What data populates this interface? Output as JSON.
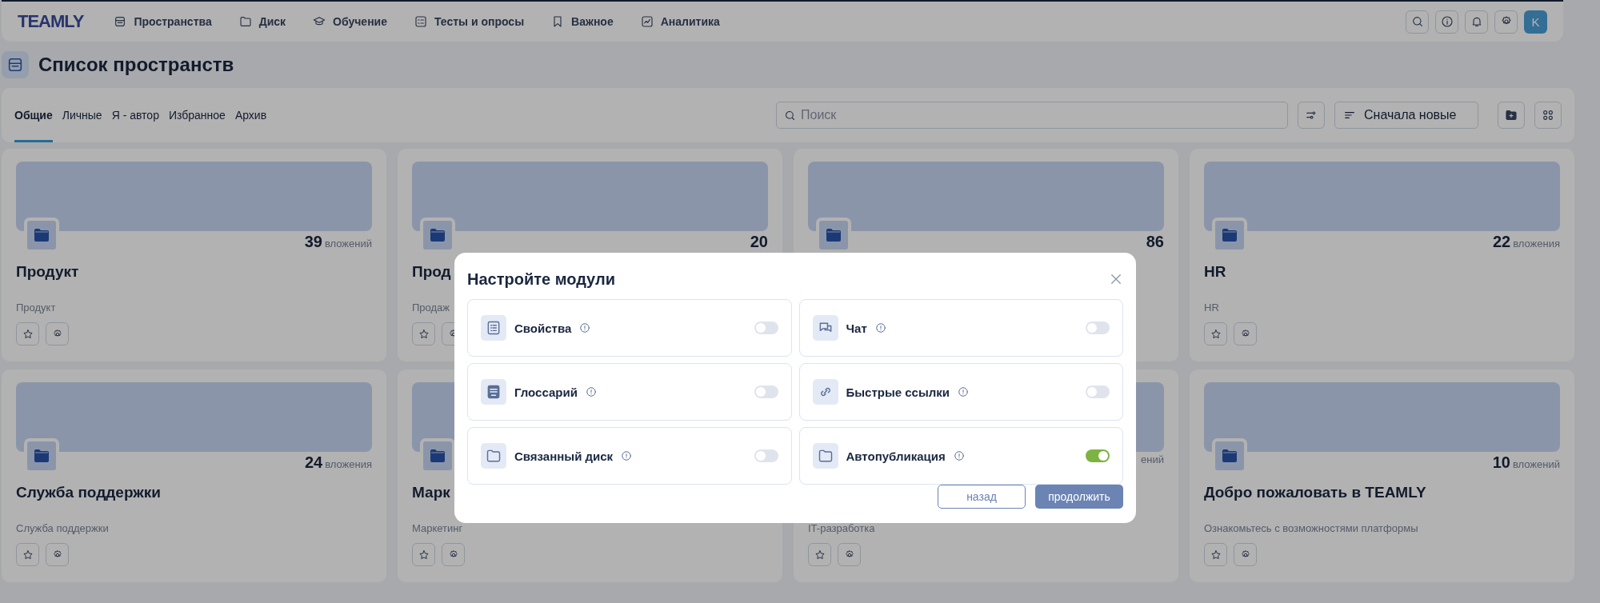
{
  "top_nav": {
    "logo": "TEAMLY",
    "items": [
      {
        "label": "Пространства"
      },
      {
        "label": "Диск"
      },
      {
        "label": "Обучение"
      },
      {
        "label": "Тесты и опросы"
      },
      {
        "label": "Важное"
      },
      {
        "label": "Аналитика"
      }
    ],
    "avatar": "K"
  },
  "page": {
    "title": "Список пространств"
  },
  "tabs": [
    {
      "label": "Общие",
      "selected": true
    },
    {
      "label": "Личные",
      "selected": false
    },
    {
      "label": "Я - автор",
      "selected": false
    },
    {
      "label": "Избранное",
      "selected": false
    },
    {
      "label": "Архив",
      "selected": false
    }
  ],
  "toolbar": {
    "search": {
      "placeholder": "Поиск"
    },
    "sort": "Сначала новые"
  },
  "cards": [
    {
      "title": "Продукт",
      "subtitle": "Продукт",
      "count": "39",
      "count_label": "вложений"
    },
    {
      "title": "Прод",
      "subtitle": "Продаж",
      "count": "20"
    },
    {
      "count": "86"
    },
    {
      "title": "HR",
      "subtitle": "HR",
      "count": "22",
      "count_label": "вложения"
    },
    {
      "title": "Служба поддержки",
      "subtitle": "Служба поддержки",
      "count": "24",
      "count_label": "вложения"
    },
    {
      "title": "Марк",
      "subtitle": "Маркетинг"
    },
    {
      "subtitle": "IT-разработка",
      "count_label": "ений"
    },
    {
      "title": "Добро пожаловать в TEAMLY",
      "subtitle": "Ознакомьтесь с возможностями платформы",
      "count": "10",
      "count_label": "вложений"
    }
  ],
  "modal": {
    "title": "Настройте модули",
    "modules": [
      {
        "label": "Свойства",
        "on": false
      },
      {
        "label": "Чат",
        "on": false
      },
      {
        "label": "Глоссарий",
        "on": false
      },
      {
        "label": "Быстрые ссылки",
        "on": false
      },
      {
        "label": "Связанный диск",
        "on": false
      },
      {
        "label": "Автопубликация",
        "on": true
      }
    ],
    "buttons": [
      {
        "label": "назад",
        "kind": "secondary"
      },
      {
        "label": "продолжить",
        "kind": "primary"
      }
    ]
  }
}
